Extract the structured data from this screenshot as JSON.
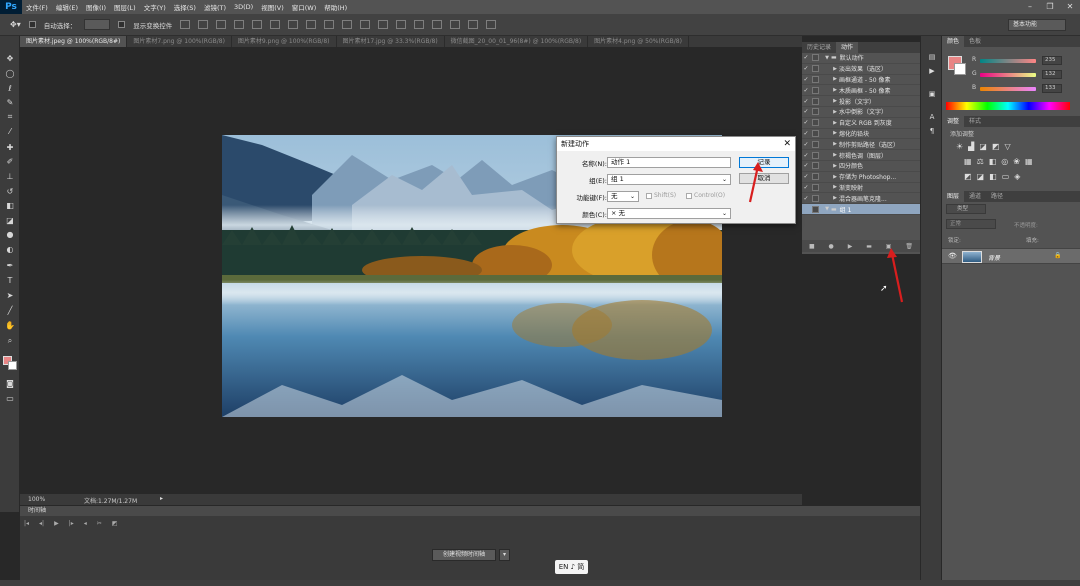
{
  "app": {
    "logo": "Ps",
    "menu": [
      "文件(F)",
      "编辑(E)",
      "图像(I)",
      "图层(L)",
      "文字(Y)",
      "选择(S)",
      "滤镜(T)",
      "3D(D)",
      "视图(V)",
      "窗口(W)",
      "帮助(H)"
    ],
    "window_controls": [
      "–",
      "❐",
      "✕"
    ]
  },
  "options_bar": {
    "auto_select_label": "自动选择：",
    "show_transform_label": "显示变换控件",
    "workspace": "基本功能"
  },
  "tabs": [
    {
      "label": "图片素材.jpeg @ 100%(RGB/8#)",
      "active": true
    },
    {
      "label": "图片素材7.png @ 100%(RGB/8)",
      "active": false
    },
    {
      "label": "图片素材9.png @ 100%(RGB/8)",
      "active": false
    },
    {
      "label": "图片素材17.jpg @ 33.3%(RGB/8)",
      "active": false
    },
    {
      "label": "微信截图_20_00_01_96(8#) @ 100%(RGB/8)",
      "active": false
    },
    {
      "label": "图片素材4.png @ 50%(RGB/8)",
      "active": false
    }
  ],
  "status": {
    "zoom": "100%",
    "doc": "文档:1.27M/1.27M"
  },
  "timeline": {
    "title": "时间轴",
    "create_button": "创建视频时间轴"
  },
  "ime": "EN ♪ 简",
  "actions_panel": {
    "tabs": [
      "历史记录",
      "动作"
    ],
    "active_tab": "动作",
    "items": [
      {
        "label": "默认动作",
        "level": 0,
        "folder": true,
        "checked": true
      },
      {
        "label": "淡出效果（选区）",
        "level": 1,
        "checked": true
      },
      {
        "label": "画框通道 - 50 像素",
        "level": 1,
        "checked": true
      },
      {
        "label": "木质画框 - 50 像素",
        "level": 1,
        "checked": true
      },
      {
        "label": "投影（文字）",
        "level": 1,
        "checked": true
      },
      {
        "label": "水中倒影（文字）",
        "level": 1,
        "checked": true
      },
      {
        "label": "自定义 RGB 到灰度",
        "level": 1,
        "checked": true
      },
      {
        "label": "熔化的铅块",
        "level": 1,
        "checked": true
      },
      {
        "label": "制作剪贴路径（选区）",
        "level": 1,
        "checked": true
      },
      {
        "label": "棕褐色调（图层）",
        "level": 1,
        "checked": true
      },
      {
        "label": "四分颜色",
        "level": 1,
        "checked": true
      },
      {
        "label": "存储为 Photoshop...",
        "level": 1,
        "checked": true
      },
      {
        "label": "渐变映射",
        "level": 1,
        "checked": true
      },
      {
        "label": "混合器画笔克隆...",
        "level": 1,
        "checked": true
      },
      {
        "label": "组 1",
        "level": 0,
        "folder": true,
        "checked": false,
        "selected": true
      }
    ]
  },
  "color_panel": {
    "tabs": [
      "颜色",
      "色板"
    ],
    "labels": [
      "R",
      "G",
      "B"
    ],
    "values": [
      "235",
      "132",
      "133"
    ],
    "fg": "#e88585",
    "bg": "#ffffff"
  },
  "adjust_panel": {
    "tabs": [
      "调整",
      "样式"
    ],
    "subtitle": "添加调整"
  },
  "layers_panel": {
    "tabs": [
      "图层",
      "通道",
      "路径"
    ],
    "kind": "类型",
    "blend": "正常",
    "opacity_label": "不透明度:",
    "lock_label": "锁定:",
    "fill_label": "填充:",
    "layer_name": "背景"
  },
  "dialog": {
    "title": "新建动作",
    "name_label": "名称(N):",
    "name_value": "动作 1",
    "group_label": "组(E):",
    "group_value": "组 1",
    "fkey_label": "功能键(F):",
    "fkey_value": "无",
    "shift_label": "Shift(S)",
    "ctrl_label": "Control(O)",
    "color_label": "颜色(C):",
    "color_value": "× 无",
    "record_button": "记录",
    "cancel_button": "取消"
  },
  "colors": {
    "accent_red": "#d81e1e",
    "ps_blue": "#31a8ff",
    "selection": "#8fa6c0"
  }
}
